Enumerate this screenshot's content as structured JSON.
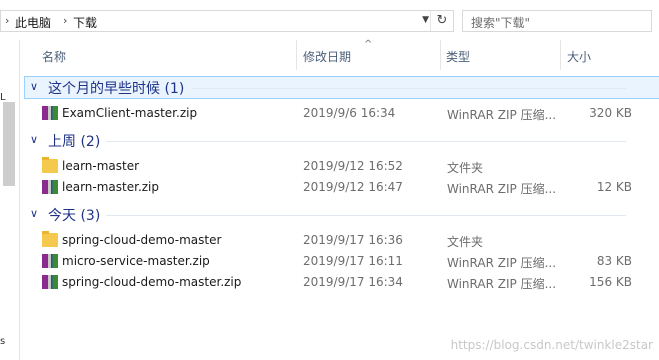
{
  "address": {
    "crumbs": [
      "此电脑",
      "下载"
    ],
    "separator": "›",
    "dropdown_icon": "chevron-down-icon",
    "refresh_icon": "refresh-icon"
  },
  "search": {
    "placeholder": "搜索\"下载\""
  },
  "columns": {
    "name": "名称",
    "date": "修改日期",
    "type": "类型",
    "size": "大小",
    "sort_indicator": "^"
  },
  "nav_fragments": {
    "top": "L",
    "bottom": "s"
  },
  "groups": [
    {
      "title": "这个月的早些时候 (1)",
      "files": [
        {
          "name": "ExamClient-master.zip",
          "date": "2019/9/6 16:34",
          "type": "WinRAR ZIP 压缩...",
          "size": "320 KB",
          "icon": "winrar-zip-icon"
        }
      ]
    },
    {
      "title": "上周 (2)",
      "files": [
        {
          "name": "learn-master",
          "date": "2019/9/12 16:52",
          "type": "文件夹",
          "size": "",
          "icon": "folder-icon"
        },
        {
          "name": "learn-master.zip",
          "date": "2019/9/12 16:47",
          "type": "WinRAR ZIP 压缩...",
          "size": "12 KB",
          "icon": "winrar-zip-icon"
        }
      ]
    },
    {
      "title": "今天 (3)",
      "files": [
        {
          "name": "spring-cloud-demo-master",
          "date": "2019/9/17 16:36",
          "type": "文件夹",
          "size": "",
          "icon": "folder-icon"
        },
        {
          "name": "micro-service-master.zip",
          "date": "2019/9/17 16:11",
          "type": "WinRAR ZIP 压缩...",
          "size": "83 KB",
          "icon": "winrar-zip-icon"
        },
        {
          "name": "spring-cloud-demo-master.zip",
          "date": "2019/9/17 16:34",
          "type": "WinRAR ZIP 压缩...",
          "size": "156 KB",
          "icon": "winrar-zip-icon"
        }
      ]
    }
  ],
  "watermark": "https://blog.csdn.net/twinkle2star"
}
